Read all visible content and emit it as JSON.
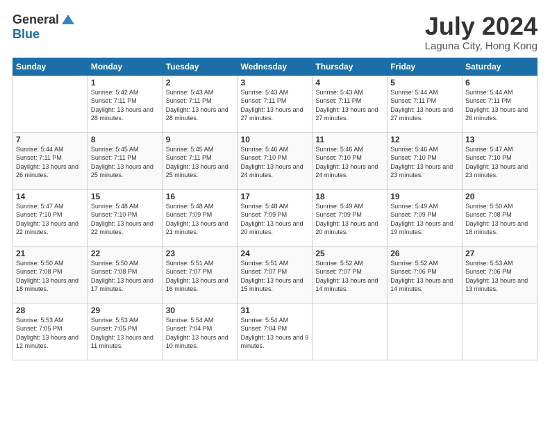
{
  "logo": {
    "general": "General",
    "blue": "Blue"
  },
  "title": {
    "month_year": "July 2024",
    "location": "Laguna City, Hong Kong"
  },
  "headers": [
    "Sunday",
    "Monday",
    "Tuesday",
    "Wednesday",
    "Thursday",
    "Friday",
    "Saturday"
  ],
  "weeks": [
    [
      {
        "day": "",
        "sunrise": "",
        "sunset": "",
        "daylight": ""
      },
      {
        "day": "1",
        "sunrise": "Sunrise: 5:42 AM",
        "sunset": "Sunset: 7:11 PM",
        "daylight": "Daylight: 13 hours and 28 minutes."
      },
      {
        "day": "2",
        "sunrise": "Sunrise: 5:43 AM",
        "sunset": "Sunset: 7:11 PM",
        "daylight": "Daylight: 13 hours and 28 minutes."
      },
      {
        "day": "3",
        "sunrise": "Sunrise: 5:43 AM",
        "sunset": "Sunset: 7:11 PM",
        "daylight": "Daylight: 13 hours and 27 minutes."
      },
      {
        "day": "4",
        "sunrise": "Sunrise: 5:43 AM",
        "sunset": "Sunset: 7:11 PM",
        "daylight": "Daylight: 13 hours and 27 minutes."
      },
      {
        "day": "5",
        "sunrise": "Sunrise: 5:44 AM",
        "sunset": "Sunset: 7:11 PM",
        "daylight": "Daylight: 13 hours and 27 minutes."
      },
      {
        "day": "6",
        "sunrise": "Sunrise: 5:44 AM",
        "sunset": "Sunset: 7:11 PM",
        "daylight": "Daylight: 13 hours and 26 minutes."
      }
    ],
    [
      {
        "day": "7",
        "sunrise": "Sunrise: 5:44 AM",
        "sunset": "Sunset: 7:11 PM",
        "daylight": "Daylight: 13 hours and 26 minutes."
      },
      {
        "day": "8",
        "sunrise": "Sunrise: 5:45 AM",
        "sunset": "Sunset: 7:11 PM",
        "daylight": "Daylight: 13 hours and 25 minutes."
      },
      {
        "day": "9",
        "sunrise": "Sunrise: 5:45 AM",
        "sunset": "Sunset: 7:11 PM",
        "daylight": "Daylight: 13 hours and 25 minutes."
      },
      {
        "day": "10",
        "sunrise": "Sunrise: 5:46 AM",
        "sunset": "Sunset: 7:10 PM",
        "daylight": "Daylight: 13 hours and 24 minutes."
      },
      {
        "day": "11",
        "sunrise": "Sunrise: 5:46 AM",
        "sunset": "Sunset: 7:10 PM",
        "daylight": "Daylight: 13 hours and 24 minutes."
      },
      {
        "day": "12",
        "sunrise": "Sunrise: 5:46 AM",
        "sunset": "Sunset: 7:10 PM",
        "daylight": "Daylight: 13 hours and 23 minutes."
      },
      {
        "day": "13",
        "sunrise": "Sunrise: 5:47 AM",
        "sunset": "Sunset: 7:10 PM",
        "daylight": "Daylight: 13 hours and 23 minutes."
      }
    ],
    [
      {
        "day": "14",
        "sunrise": "Sunrise: 5:47 AM",
        "sunset": "Sunset: 7:10 PM",
        "daylight": "Daylight: 13 hours and 22 minutes."
      },
      {
        "day": "15",
        "sunrise": "Sunrise: 5:48 AM",
        "sunset": "Sunset: 7:10 PM",
        "daylight": "Daylight: 13 hours and 22 minutes."
      },
      {
        "day": "16",
        "sunrise": "Sunrise: 5:48 AM",
        "sunset": "Sunset: 7:09 PM",
        "daylight": "Daylight: 13 hours and 21 minutes."
      },
      {
        "day": "17",
        "sunrise": "Sunrise: 5:48 AM",
        "sunset": "Sunset: 7:09 PM",
        "daylight": "Daylight: 13 hours and 20 minutes."
      },
      {
        "day": "18",
        "sunrise": "Sunrise: 5:49 AM",
        "sunset": "Sunset: 7:09 PM",
        "daylight": "Daylight: 13 hours and 20 minutes."
      },
      {
        "day": "19",
        "sunrise": "Sunrise: 5:49 AM",
        "sunset": "Sunset: 7:09 PM",
        "daylight": "Daylight: 13 hours and 19 minutes."
      },
      {
        "day": "20",
        "sunrise": "Sunrise: 5:50 AM",
        "sunset": "Sunset: 7:08 PM",
        "daylight": "Daylight: 13 hours and 18 minutes."
      }
    ],
    [
      {
        "day": "21",
        "sunrise": "Sunrise: 5:50 AM",
        "sunset": "Sunset: 7:08 PM",
        "daylight": "Daylight: 13 hours and 18 minutes."
      },
      {
        "day": "22",
        "sunrise": "Sunrise: 5:50 AM",
        "sunset": "Sunset: 7:08 PM",
        "daylight": "Daylight: 13 hours and 17 minutes."
      },
      {
        "day": "23",
        "sunrise": "Sunrise: 5:51 AM",
        "sunset": "Sunset: 7:07 PM",
        "daylight": "Daylight: 13 hours and 16 minutes."
      },
      {
        "day": "24",
        "sunrise": "Sunrise: 5:51 AM",
        "sunset": "Sunset: 7:07 PM",
        "daylight": "Daylight: 13 hours and 15 minutes."
      },
      {
        "day": "25",
        "sunrise": "Sunrise: 5:52 AM",
        "sunset": "Sunset: 7:07 PM",
        "daylight": "Daylight: 13 hours and 14 minutes."
      },
      {
        "day": "26",
        "sunrise": "Sunrise: 5:52 AM",
        "sunset": "Sunset: 7:06 PM",
        "daylight": "Daylight: 13 hours and 14 minutes."
      },
      {
        "day": "27",
        "sunrise": "Sunrise: 5:53 AM",
        "sunset": "Sunset: 7:06 PM",
        "daylight": "Daylight: 13 hours and 13 minutes."
      }
    ],
    [
      {
        "day": "28",
        "sunrise": "Sunrise: 5:53 AM",
        "sunset": "Sunset: 7:05 PM",
        "daylight": "Daylight: 13 hours and 12 minutes."
      },
      {
        "day": "29",
        "sunrise": "Sunrise: 5:53 AM",
        "sunset": "Sunset: 7:05 PM",
        "daylight": "Daylight: 13 hours and 11 minutes."
      },
      {
        "day": "30",
        "sunrise": "Sunrise: 5:54 AM",
        "sunset": "Sunset: 7:04 PM",
        "daylight": "Daylight: 13 hours and 10 minutes."
      },
      {
        "day": "31",
        "sunrise": "Sunrise: 5:54 AM",
        "sunset": "Sunset: 7:04 PM",
        "daylight": "Daylight: 13 hours and 9 minutes."
      },
      {
        "day": "",
        "sunrise": "",
        "sunset": "",
        "daylight": ""
      },
      {
        "day": "",
        "sunrise": "",
        "sunset": "",
        "daylight": ""
      },
      {
        "day": "",
        "sunrise": "",
        "sunset": "",
        "daylight": ""
      }
    ]
  ]
}
